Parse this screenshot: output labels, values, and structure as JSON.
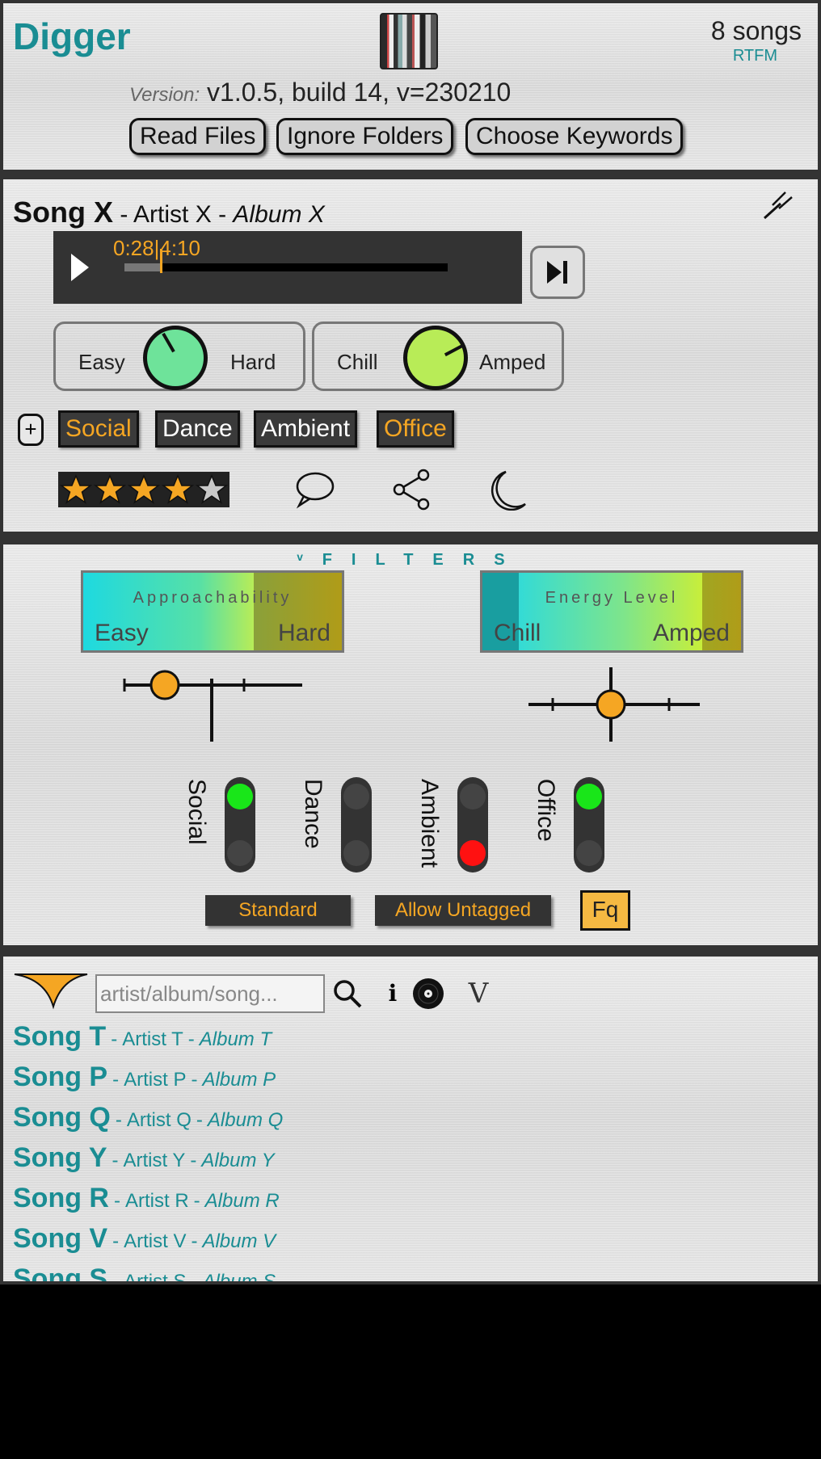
{
  "header": {
    "app_title": "Digger",
    "song_count": "8 songs",
    "rtfm": "RTFM",
    "version_label": "Version:",
    "version_value": "v1.0.5, build 14, v=230210",
    "buttons": {
      "read_files": "Read Files",
      "ignore_folders": "Ignore Folders",
      "choose_keywords": "Choose Keywords"
    }
  },
  "player": {
    "song": "Song X",
    "sep1": "-",
    "artist": "Artist X",
    "sep2": "-",
    "album": "Album X",
    "elapsed": "0:28",
    "duration": "4:10",
    "progress_fraction": 0.11,
    "knobs": [
      {
        "low": "Easy",
        "high": "Hard",
        "color": "#6ee39a",
        "angle": -30
      },
      {
        "low": "Chill",
        "high": "Amped",
        "color": "#b8ec57",
        "angle": 62
      }
    ],
    "tags": [
      {
        "label": "Social",
        "on": true
      },
      {
        "label": "Dance",
        "on": false
      },
      {
        "label": "Ambient",
        "on": false
      },
      {
        "label": "Office",
        "on": true
      }
    ],
    "rating": 4,
    "max_rating": 5
  },
  "filters": {
    "title": "ᵛFILTERS",
    "approachability": {
      "caption": "Approachability",
      "low": "Easy",
      "high": "Hard"
    },
    "energy": {
      "caption": "Energy Level",
      "low": "Chill",
      "high": "Amped"
    },
    "toggles": [
      {
        "label": "Social",
        "top": "green",
        "bottom": "off"
      },
      {
        "label": "Dance",
        "top": "off",
        "bottom": "off"
      },
      {
        "label": "Ambient",
        "top": "off",
        "bottom": "red"
      },
      {
        "label": "Office",
        "top": "green",
        "bottom": "off"
      }
    ],
    "standard_label": "Standard",
    "allow_untagged_label": "Allow Untagged",
    "fq_label": "Fq"
  },
  "songlist": {
    "search_placeholder": "artist/album/song...",
    "info_label": "i",
    "v_label": "V",
    "songs": [
      {
        "song": "Song T",
        "artist": "Artist T",
        "album": "Album T"
      },
      {
        "song": "Song P",
        "artist": "Artist P",
        "album": "Album P"
      },
      {
        "song": "Song Q",
        "artist": "Artist Q",
        "album": "Album Q"
      },
      {
        "song": "Song Y",
        "artist": "Artist Y",
        "album": "Album Y"
      },
      {
        "song": "Song R",
        "artist": "Artist R",
        "album": "Album R"
      },
      {
        "song": "Song V",
        "artist": "Artist V",
        "album": "Album V"
      },
      {
        "song": "Song S",
        "artist": "Artist S",
        "album": "Album S"
      }
    ],
    "separator": "-"
  },
  "colors": {
    "accent": "#1a8d93",
    "orange": "#f5a623",
    "dark": "#333333"
  }
}
